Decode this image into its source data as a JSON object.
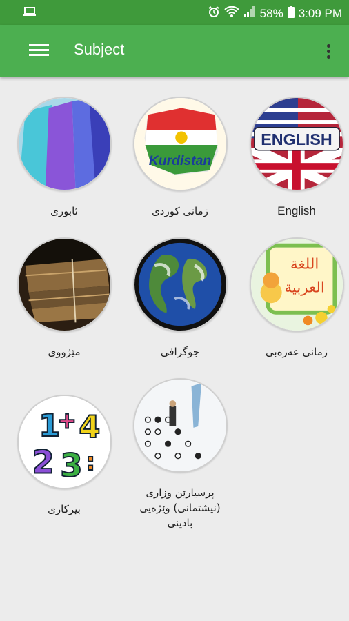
{
  "status_bar": {
    "battery": "58%",
    "time": "3:09 PM"
  },
  "app_bar": {
    "title": "Subject"
  },
  "subjects": [
    {
      "label": "ئابوری",
      "icon": "economy-image"
    },
    {
      "label": "زمانی کوردی",
      "icon": "kurdistan-flag-image"
    },
    {
      "label": "English",
      "icon": "english-flag-image"
    },
    {
      "label": "مێژووی",
      "icon": "history-books-image"
    },
    {
      "label": "جوگرافی",
      "icon": "globe-image"
    },
    {
      "label": "زمانی عەرەبی",
      "icon": "arabic-language-image"
    },
    {
      "label": "بیرکاری",
      "icon": "math-numbers-image"
    },
    {
      "label": "پرسیارێن وزاری (نیشتمانی) وێژەیی بادینی",
      "icon": "exam-sheet-image"
    }
  ],
  "colors": {
    "status_bar": "#3f9a3b",
    "app_bar": "#4caf50",
    "background": "#ececec"
  }
}
